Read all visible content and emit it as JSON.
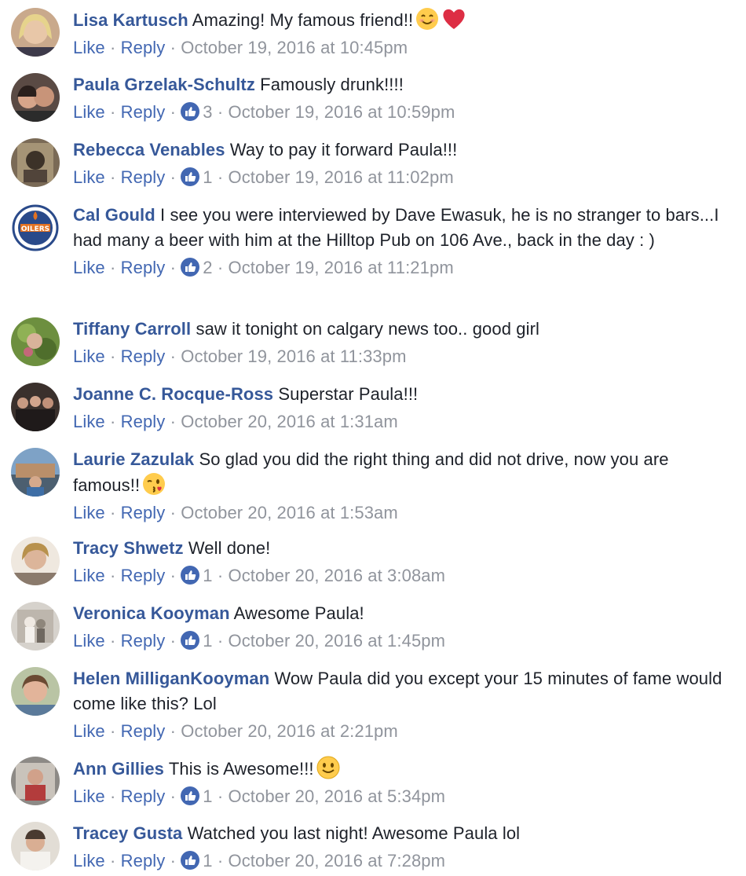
{
  "like_label": "Like",
  "reply_label": "Reply",
  "separator": "·",
  "colors": {
    "name": "#365899",
    "link": "#4267b2",
    "meta": "#90949c",
    "like_badge": "#4267b2"
  },
  "comments": [
    {
      "author": "Lisa Kartusch",
      "text": "Amazing! My famous friend!!",
      "emoji": [
        "smiling-face-icon",
        "red-heart-icon"
      ],
      "likes": "",
      "timestamp": "October 19, 2016 at 10:45pm"
    },
    {
      "author": "Paula Grzelak-Schultz",
      "text": "Famously drunk!!!!",
      "emoji": [],
      "likes": "3",
      "timestamp": "October 19, 2016 at 10:59pm"
    },
    {
      "author": "Rebecca Venables",
      "text": "Way to pay it forward Paula!!!",
      "emoji": [],
      "likes": "1",
      "timestamp": "October 19, 2016 at 11:02pm"
    },
    {
      "author": "Cal Gould",
      "text": "I see you were interviewed by Dave Ewasuk, he is no stranger to bars...I had many a beer with him at the Hilltop Pub on 106 Ave., back in the day : )",
      "emoji": [],
      "likes": "2",
      "timestamp": "October 19, 2016 at 11:21pm"
    },
    {
      "author": "Tiffany Carroll",
      "text": "saw it tonight on calgary news too.. good girl",
      "emoji": [],
      "likes": "",
      "timestamp": "October 19, 2016 at 11:33pm"
    },
    {
      "author": "Joanne C. Rocque-Ross",
      "text": "Superstar Paula!!!",
      "emoji": [],
      "likes": "",
      "timestamp": "October 20, 2016 at 1:31am"
    },
    {
      "author": "Laurie Zazulak",
      "text": "So glad you did the right thing and did not drive, now you are famous!!",
      "emoji": [
        "kissing-wink-face-icon"
      ],
      "likes": "",
      "timestamp": "October 20, 2016 at 1:53am"
    },
    {
      "author": "Tracy Shwetz",
      "text": "Well done!",
      "emoji": [],
      "likes": "1",
      "timestamp": "October 20, 2016 at 3:08am"
    },
    {
      "author": "Veronica Kooyman",
      "text": "Awesome Paula!",
      "emoji": [],
      "likes": "1",
      "timestamp": "October 20, 2016 at 1:45pm"
    },
    {
      "author": "Helen MilliganKooyman",
      "text": "Wow Paula did you except your 15 minutes of fame would come like this? Lol",
      "emoji": [],
      "likes": "",
      "timestamp": "October 20, 2016 at 2:21pm"
    },
    {
      "author": "Ann Gillies",
      "text": "This is Awesome!!!",
      "emoji": [
        "slight-smile-face-icon"
      ],
      "likes": "1",
      "timestamp": "October 20, 2016 at 5:34pm"
    },
    {
      "author": "Tracey Gusta",
      "text": "Watched you last night! Awesome Paula lol",
      "emoji": [],
      "likes": "1",
      "timestamp": "October 20, 2016 at 7:28pm"
    }
  ]
}
